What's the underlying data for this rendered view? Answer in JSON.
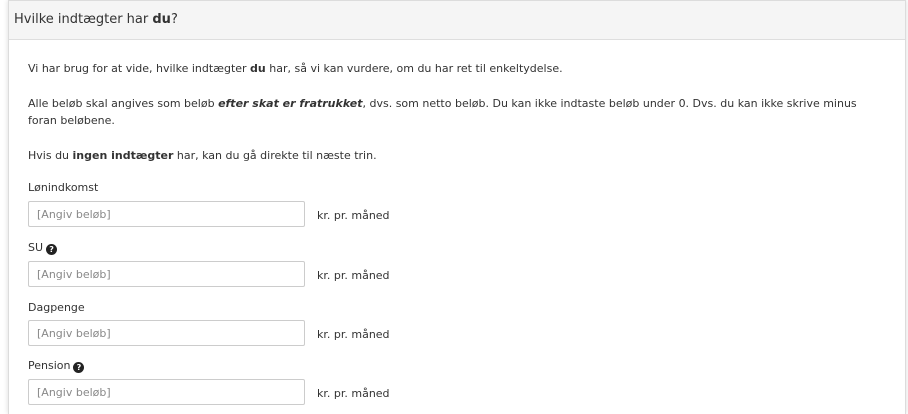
{
  "heading": {
    "prefix": "Hvilke indtægter har ",
    "bold": "du",
    "suffix": "?"
  },
  "intro": {
    "p1": {
      "before": "Vi har brug for at vide, hvilke indtægter ",
      "bold": "du",
      "after": " har, så vi kan vurdere, om du har ret til enkeltydelse."
    },
    "p2": {
      "before": "Alle beløb skal angives som beløb ",
      "bold_italic": "efter skat er fratrukket",
      "after": ", dvs. som netto beløb. Du kan ikke indtaste beløb under 0. Dvs. du kan ikke skrive minus foran beløbene."
    },
    "p3": {
      "before": "Hvis du ",
      "bold": "ingen indtægter",
      "after": " har, kan du gå direkte til næste trin."
    }
  },
  "fields": [
    {
      "label": "Lønindkomst",
      "placeholder": "[Angiv beløb]",
      "unit": "kr. pr. måned",
      "help": false
    },
    {
      "label": "SU",
      "placeholder": "[Angiv beløb]",
      "unit": "kr. pr. måned",
      "help": true
    },
    {
      "label": "Dagpenge",
      "placeholder": "[Angiv beløb]",
      "unit": "kr. pr. måned",
      "help": false
    },
    {
      "label": "Pension",
      "placeholder": "[Angiv beløb]",
      "unit": "kr. pr. måned",
      "help": true
    }
  ],
  "help_icon_glyph": "?"
}
